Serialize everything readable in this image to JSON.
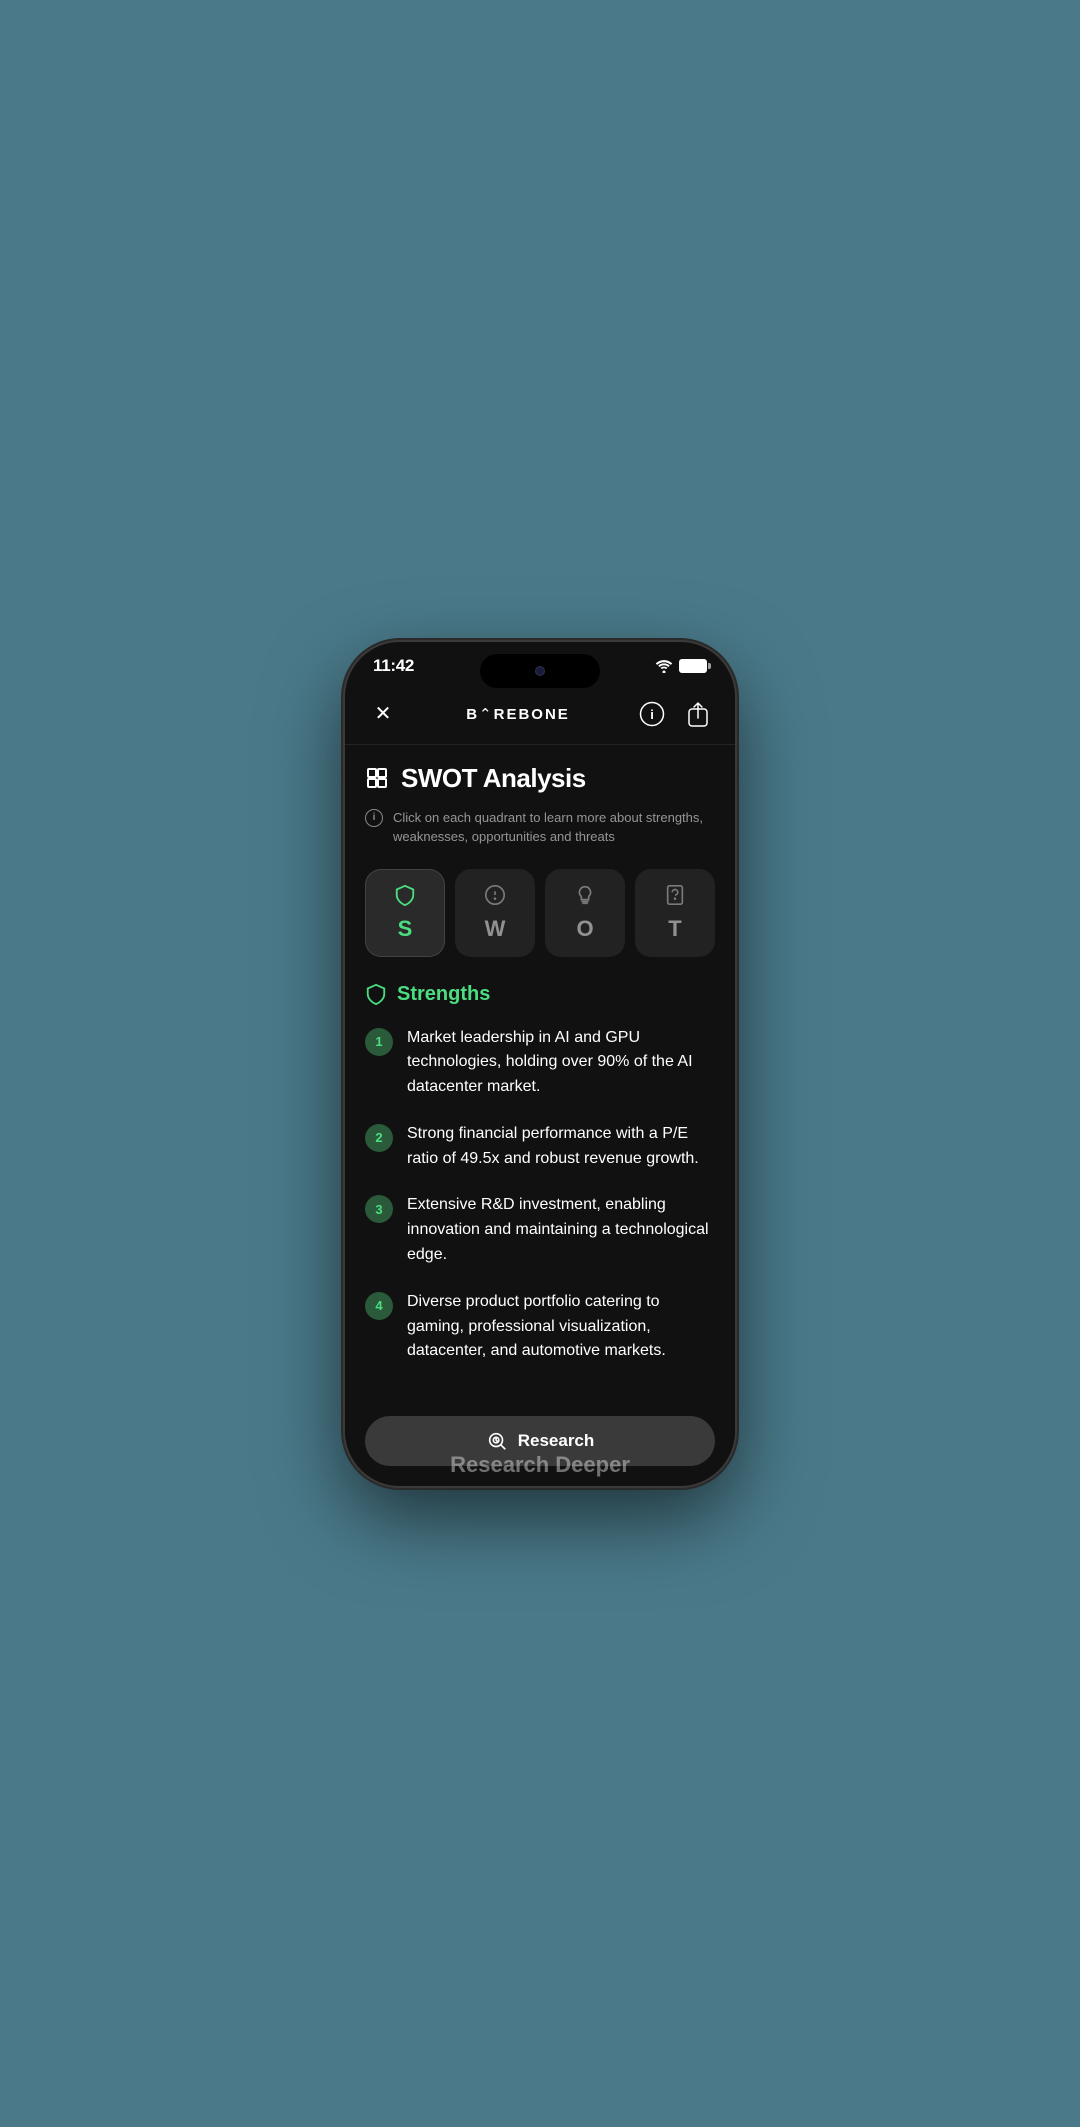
{
  "status_bar": {
    "time": "11:42"
  },
  "nav": {
    "close_label": "×",
    "title": "B⌃REBONE",
    "info_btn": "ⓘ",
    "share_btn": "↑"
  },
  "page": {
    "title": "SWOT Analysis",
    "info_text": "Click on each quadrant to learn more about strengths, weaknesses, opportunities and threats"
  },
  "swot_tabs": [
    {
      "letter": "S",
      "label": "S",
      "active": true
    },
    {
      "letter": "W",
      "label": "W",
      "active": false
    },
    {
      "letter": "O",
      "label": "O",
      "active": false
    },
    {
      "letter": "T",
      "label": "T",
      "active": false
    }
  ],
  "section": {
    "title": "Strengths"
  },
  "strengths": [
    {
      "number": "1",
      "text": "Market leadership in AI and GPU technologies, holding over 90% of the AI datacenter market."
    },
    {
      "number": "2",
      "text": "Strong financial performance with a P/E ratio of 49.5x and robust revenue growth."
    },
    {
      "number": "3",
      "text": "Extensive R&D investment, enabling innovation and maintaining a technological edge."
    },
    {
      "number": "4",
      "text": "Diverse product portfolio catering to gaming, professional visualization, datacenter, and automotive markets."
    }
  ],
  "research_button": {
    "label": "Research"
  },
  "bottom_peek": {
    "text": "Research Deeper"
  }
}
